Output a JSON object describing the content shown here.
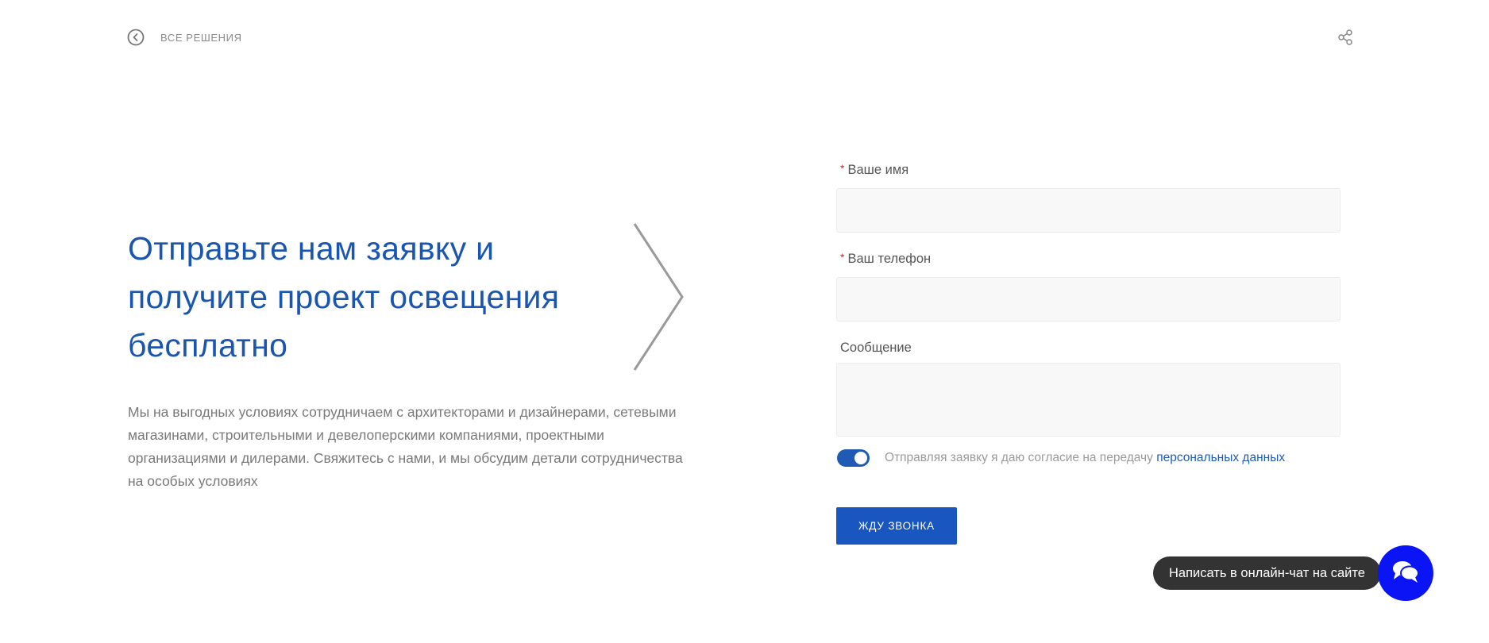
{
  "nav": {
    "back_label": "ВСЕ РЕШЕНИЯ",
    "back_icon": "back-circle-icon",
    "share_icon": "share-icon"
  },
  "hero": {
    "title": "Отправьте нам заявку и получите проект освещения бесплатно",
    "description": "Мы на выгодных условиях сотрудничаем с архитекторами и дизайнерами, сетевыми магазинами, строительными и девелоперскими компаниями, проектными организациями и дилерами. Свяжитесь с нами, и мы обсудим детали сотрудничества на особых условиях"
  },
  "form": {
    "name_label": "Ваше имя",
    "name_value": "",
    "phone_label": "Ваш телефон",
    "phone_value": "",
    "message_label": "Сообщение",
    "message_value": "",
    "required_mark": "*",
    "consent_text": "Отправляя заявку я даю согласие на передачу",
    "consent_link": "персональных данных",
    "consent_checked": true,
    "submit_label": "ЖДУ ЗВОНКА"
  },
  "chat": {
    "label": "Написать в онлайн-чат на сайте",
    "icon": "chat-bubbles-icon"
  },
  "colors": {
    "accent": "#1a56bf",
    "title": "#1a56b0",
    "chat_button": "#0a14f5",
    "chat_bubble": "#333333",
    "required": "#d2232a"
  }
}
